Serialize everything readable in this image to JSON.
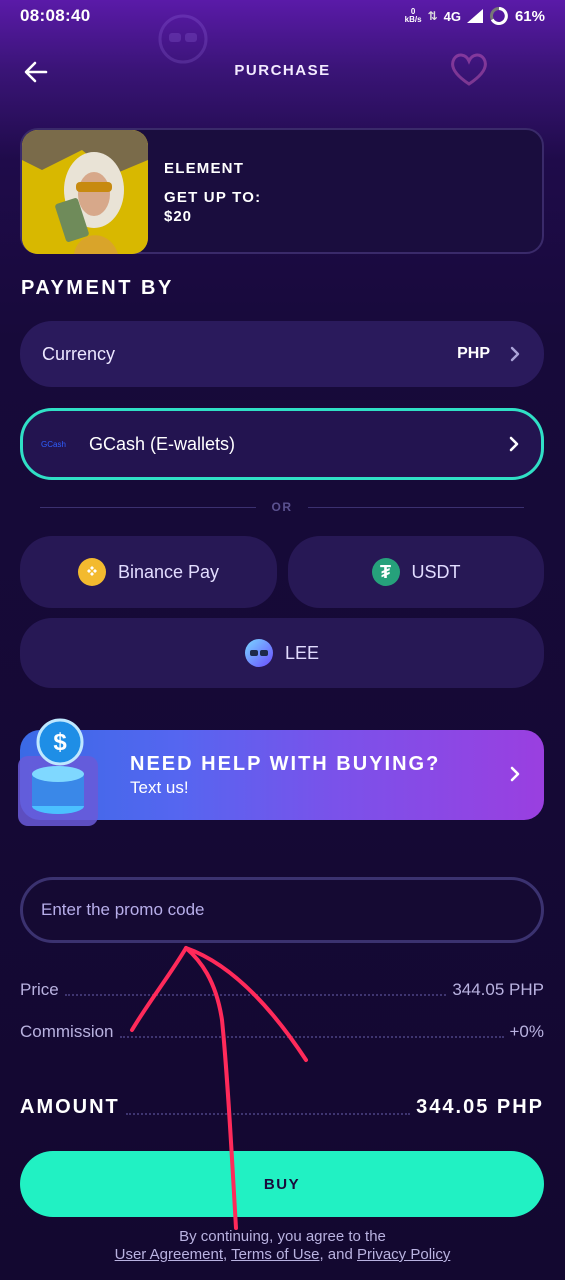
{
  "status_bar": {
    "time": "08:08:40",
    "net_speed_top": "0",
    "net_speed_bottom": "kB/s",
    "network": "4G",
    "battery": "61%"
  },
  "header": {
    "title": "PURCHASE"
  },
  "product": {
    "name": "ELEMENT",
    "subtitle": "GET UP TO:",
    "amount": "$20"
  },
  "payment": {
    "section_title": "PAYMENT BY",
    "currency_label": "Currency",
    "currency_value": "PHP",
    "selected_method": "GCash (E-wallets)",
    "selected_method_logo": "GCash",
    "or_label": "OR",
    "alt_methods": [
      "Binance Pay",
      "USDT",
      "LEE"
    ]
  },
  "help": {
    "title": "NEED HELP WITH BUYING?",
    "subtitle": "Text us!"
  },
  "promo": {
    "placeholder": "Enter the promo code"
  },
  "totals": {
    "price_label": "Price",
    "price_value": "344.05 PHP",
    "commission_label": "Commission",
    "commission_value": "+0%",
    "amount_label": "AMOUNT",
    "amount_value": "344.05 PHP"
  },
  "buy_label": "BUY",
  "legal": {
    "line1": "By continuing, you agree to the",
    "user_agreement": "User Agreement",
    "terms": "Terms of Use",
    "and": ", and",
    "privacy": "Privacy Policy"
  },
  "colors": {
    "accent": "#21f1c3",
    "selected_border": "#30e0c6",
    "background": "#170a3a",
    "annotation_red": "#ff2a5a"
  }
}
